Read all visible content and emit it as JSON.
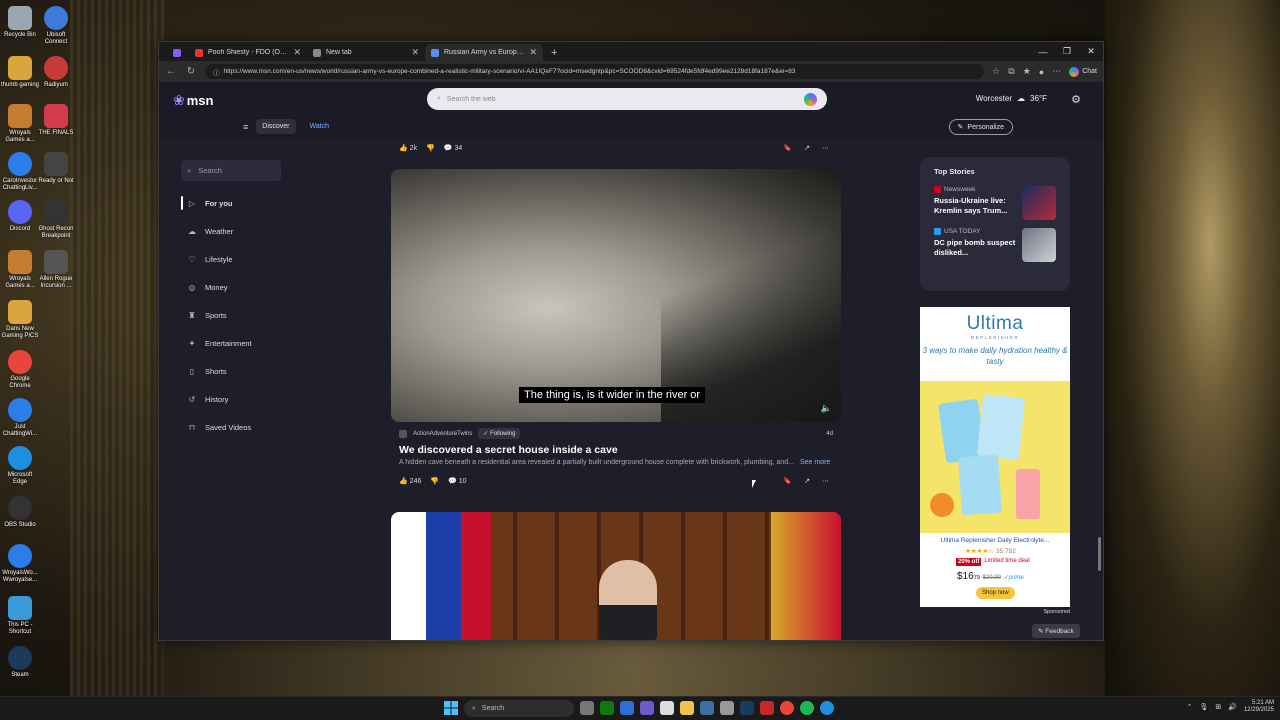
{
  "desktop_icons": [
    {
      "label": "Recycle Bin",
      "color": "#9aa7b0"
    },
    {
      "label": "Ubisoft Connect",
      "color": "#3d7bd9"
    },
    {
      "label": "thumb gaming",
      "color": "#d9a53c"
    },
    {
      "label": "Radiyum",
      "color": "#c83a3a"
    },
    {
      "label": "Wroyals Games a...",
      "color": "#c47b32"
    },
    {
      "label": "THE FINALS",
      "color": "#d33b4b"
    },
    {
      "label": "CaroInvestor ChattingLiv...",
      "color": "#2b7de9"
    },
    {
      "label": "Ready or Not",
      "color": "#444"
    },
    {
      "label": "Discord",
      "color": "#5865f2"
    },
    {
      "label": "Ghost Recon Breakpoint",
      "color": "#333"
    },
    {
      "label": "Wroyals Games a...",
      "color": "#c47b32"
    },
    {
      "label": "Allen Rogue Incursion ...",
      "color": "#555"
    },
    {
      "label": "Dans New Gaming PICS",
      "color": "#d9a53c"
    },
    {
      "label": "Google Chrome",
      "color": "#e8453c"
    },
    {
      "label": "Just ChattingWi...",
      "color": "#2b7de9"
    },
    {
      "label": "Microsoft Edge",
      "color": "#1d8fe0"
    },
    {
      "label": "OBS Studio",
      "color": "#333"
    },
    {
      "label": "WroyalsWo... Wwroyalse...",
      "color": "#2b7de9"
    },
    {
      "label": "This PC - Shortcut",
      "color": "#3a9ad9"
    },
    {
      "label": "Steam",
      "color": "#1b3a5c"
    }
  ],
  "browser": {
    "tabs": [
      {
        "title": "",
        "color": "#8a5cf6"
      },
      {
        "title": "Pooh Shiesty - FDO (Official Music...",
        "color": "#e33"
      },
      {
        "title": "New tab",
        "color": "#888"
      },
      {
        "title": "Russian Army vs Europe Comb...",
        "color": "#5b8def",
        "active": true
      }
    ],
    "new_tab": "+",
    "controls": [
      "—",
      "❐",
      "✕"
    ],
    "url": "https://www.msn.com/en-us/news/world/russian-army-vs-europe-combined-a-realistic-military-scenario/vi-AA1IQeF7?ocid=msedgntp&pc=SCOOD8&cvid=69524fde5fdf4ed99ee2128d18fa187e&ei=83",
    "chat_label": "Chat"
  },
  "msn": {
    "logo": "msn",
    "search_placeholder": "Search the web",
    "weather_city": "Worcester",
    "weather_temp": "36°F",
    "nav": {
      "discover": "Discover",
      "watch": "Watch"
    },
    "personalize": "Personalize",
    "sidebar": {
      "search_placeholder": "Search",
      "items": [
        "For you",
        "Weather",
        "Lifestyle",
        "Money",
        "Sports",
        "Entertainment",
        "Shorts",
        "History",
        "Saved Videos"
      ]
    },
    "prev_post": {
      "likes": "2k",
      "comments": "34"
    },
    "video": {
      "caption": "The thing is, is it wider in the river or",
      "source": "ActionAdventureTwins",
      "following": "Following",
      "age": "4d",
      "title": "We discovered a secret house inside a cave",
      "description": "A hidden cave beneath a residential area revealed a partially built underground house complete with brickwork, plumbing, and...",
      "see_more": "See more",
      "likes": "246",
      "comments": "10"
    },
    "top_stories": {
      "title": "Top Stories",
      "items": [
        {
          "source": "Newsweek",
          "headline": "Russia-Ukraine live: Kremlin says Trum...",
          "color": "#d0021b"
        },
        {
          "source": "USA TODAY",
          "headline": "DC pipe bomb suspect disliked...",
          "color": "#2b9af3"
        }
      ]
    },
    "ad": {
      "brand": "Ultima",
      "brand_sub": "REPLENISHER",
      "tagline": "3 ways to make daily hydration healthy & tasty",
      "product": "Ultima Replenisher Daily Electrolyte...",
      "rating_count": "35,792",
      "discount": "20% off",
      "deal": "Limited time deal",
      "price": "$16",
      "price_cents": "79",
      "old_price": "$20.99",
      "prime": "✓prime",
      "shop": "Shop now",
      "sponsored": "Sponsored"
    },
    "feedback": "Feedback"
  },
  "taskbar": {
    "search": "Search",
    "time": "5:21 AM",
    "date": "12/29/2025"
  }
}
